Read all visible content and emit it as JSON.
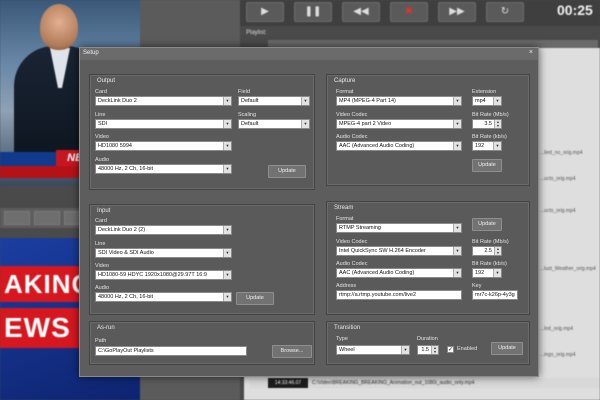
{
  "background": {
    "news_tag": "NEW",
    "breaking_line1": "AKING",
    "breaking_line2": "EWS",
    "transport": {
      "play_icon": "play-icon",
      "pause_icon": "pause-icon",
      "previous_icon": "skip-back-icon",
      "stop_icon": "stop-icon",
      "next_icon": "fast-forward-icon",
      "loop_icon": "loop-icon",
      "time": "00:25"
    },
    "playlist_label": "Playlist:",
    "bottom_row": {
      "time": "14:33:46.07",
      "file": "C:\\Video\\BREAKING_BREAKING_Animation_out_1080i_audio_only.mp4"
    },
    "right_items": [
      "...lied_no_orig.mp4",
      "...ucts_orig.mp4",
      "...ucts_orig.mp4",
      "...lust_Weather_orig.mp4",
      "...lod_orig.mp4",
      "...ings_orig.mp4"
    ]
  },
  "dialog": {
    "title": "Setup",
    "close_label": "×",
    "output": {
      "title": "Output",
      "card_label": "Card",
      "card_value": "DeckLink Duo 2",
      "field_label": "Field",
      "field_value": "Default",
      "line_label": "Line",
      "line_value": "SDI",
      "scaling_label": "Scaling",
      "scaling_value": "Default",
      "video_label": "Video",
      "video_value": "HD1080 5994",
      "audio_label": "Audio",
      "audio_value": "48000 Hz, 2 Ch, 16-bit",
      "update_label": "Update"
    },
    "capture": {
      "title": "Capture",
      "format_label": "Format",
      "format_value": "MP4 (MPEG-4 Part 14)",
      "extension_label": "Extension",
      "extension_value": "mp4",
      "video_codec_label": "Video Codec",
      "video_codec_value": "MPEG-4 part 2 Video",
      "bitrate_v_label": "Bit Rate (Mb/s)",
      "bitrate_v_value": "3.5",
      "audio_codec_label": "Audio Codec",
      "audio_codec_value": "AAC (Advanced Audio Coding)",
      "bitrate_a_label": "Bit Rate (kb/s)",
      "bitrate_a_value": "192",
      "update_label": "Update"
    },
    "input": {
      "title": "Input",
      "card_label": "Card",
      "card_value": "DeckLink Duo 2 (2)",
      "line_label": "Line",
      "line_value": "SDI Video & SDI Audio",
      "video_label": "Video",
      "video_value": "HD1080-59 HDYC 1920x1080@29.97Т 16:9",
      "audio_label": "Audio",
      "audio_value": "48000 Hz, 2 Ch, 16-bit",
      "update_label": "Update"
    },
    "stream": {
      "title": "Stream",
      "format_label": "Format",
      "format_value": "RTMP Streaming",
      "update_label": "Update",
      "video_codec_label": "Video Codec",
      "video_codec_value": "Intel QuickSync SW H.264 Encoder",
      "bitrate_v_label": "Bit Rate (Mb/s)",
      "bitrate_v_value": "2.5",
      "audio_codec_label": "Audio Codec",
      "audio_codec_value": "AAC (Advanced Audio Coding)",
      "bitrate_a_label": "Bit Rate (kb/s)",
      "bitrate_a_value": "192",
      "address_label": "Address",
      "address_value": "rtmp://a.rtmp.youtube.com/live2",
      "key_label": "Key",
      "key_value": "mr7c-k26p-4y3g"
    },
    "asrun": {
      "title": "As-run",
      "path_label": "Path",
      "path_value": "C:\\GoPlayOut Playlists",
      "browse_label": "Browse..."
    },
    "transition": {
      "title": "Transition",
      "type_label": "Type",
      "type_value": "Wheel",
      "duration_label": "Duration",
      "duration_value": "1.5",
      "enabled_label": "Enabled",
      "enabled_checked": true,
      "update_label": "Update"
    }
  }
}
